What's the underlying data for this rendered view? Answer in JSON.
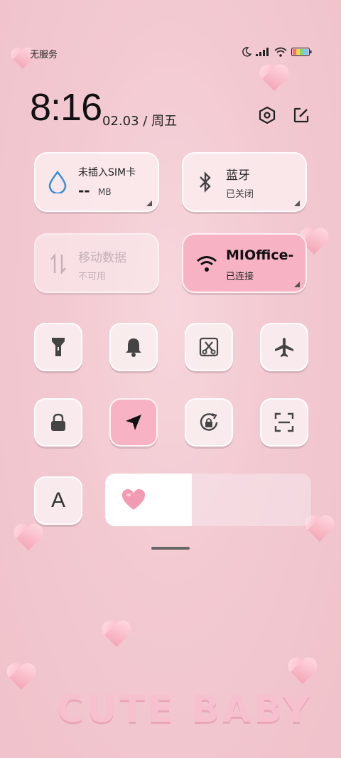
{
  "status": {
    "carrier": "无服务"
  },
  "clock": {
    "time": "8:16",
    "date": "02.03",
    "sep": "/",
    "weekday": "周五"
  },
  "cards": {
    "sim": {
      "title": "未插入SIM卡",
      "value": "--",
      "unit": "MB"
    },
    "bluetooth": {
      "title": "蓝牙",
      "status": "已关闭"
    },
    "mobile_data": {
      "title": "移动数据",
      "status": "不可用"
    },
    "wifi": {
      "title": "MIOffice-",
      "status": "已连接"
    }
  },
  "toggles": [
    {
      "icon": "flashlight-icon"
    },
    {
      "icon": "bell-icon"
    },
    {
      "icon": "screenshot-icon"
    },
    {
      "icon": "airplane-icon"
    },
    {
      "icon": "lock-icon"
    },
    {
      "icon": "location-icon",
      "active": true
    },
    {
      "icon": "rotation-lock-icon"
    },
    {
      "icon": "scan-icon"
    }
  ],
  "font_button": {
    "label": "A"
  },
  "brightness": {
    "level": 0.42
  },
  "wallpaper_text": "CUTE BABY",
  "colors": {
    "accent_pink": "#f7b3c4",
    "drop_blue": "#3a8fd8"
  }
}
